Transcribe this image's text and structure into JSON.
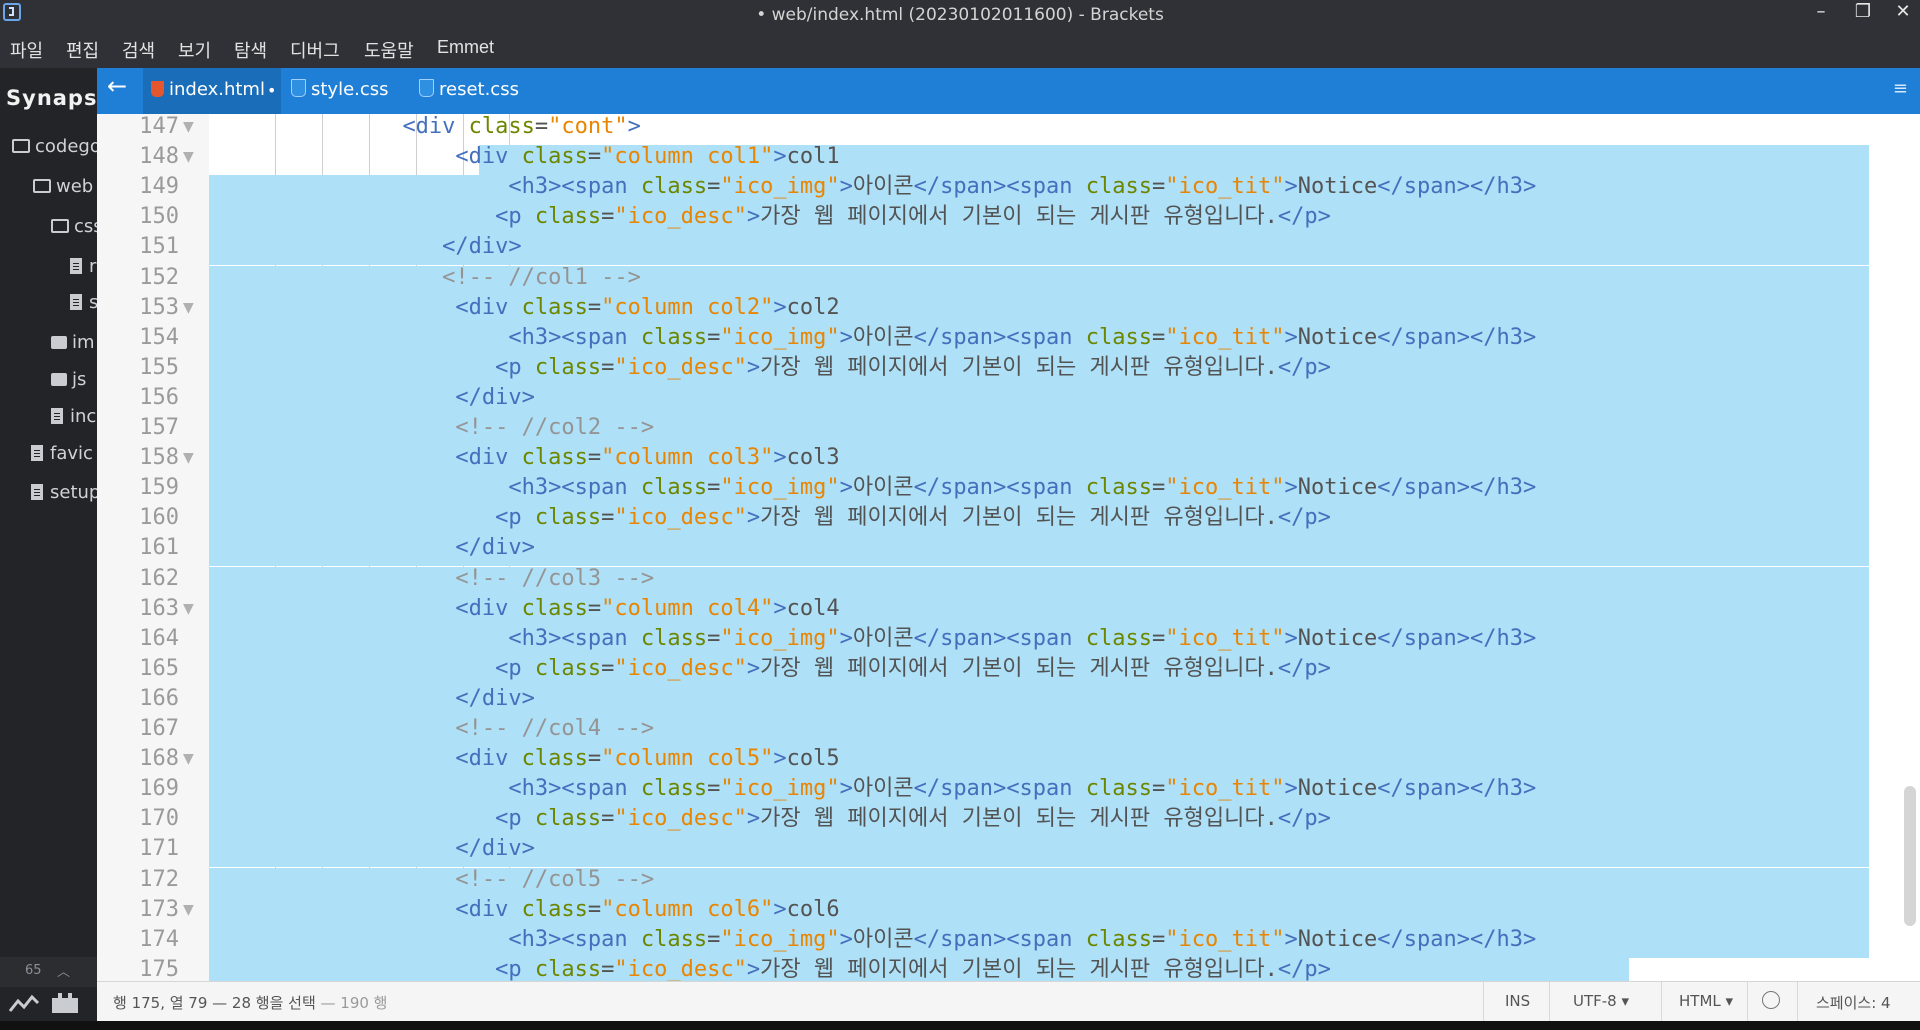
{
  "window": {
    "title": "• web/index.html (20230102011600) - Brackets",
    "minimize": "–",
    "restore": "❐",
    "close": "✕"
  },
  "menu": [
    "파일",
    "편집",
    "검색",
    "보기",
    "탐색",
    "디버그",
    "도움말",
    "Emmet"
  ],
  "sidebar": {
    "project": "Synapse",
    "items": [
      {
        "label": "codego",
        "type": "folder-open"
      },
      {
        "label": "web",
        "type": "folder-open"
      },
      {
        "label": "css",
        "type": "folder-open"
      },
      {
        "label": "r",
        "type": "file"
      },
      {
        "label": "s",
        "type": "file"
      },
      {
        "label": "im",
        "type": "folder"
      },
      {
        "label": "js",
        "type": "folder"
      },
      {
        "label": "inc",
        "type": "file"
      },
      {
        "label": "favic",
        "type": "file"
      },
      {
        "label": "setup",
        "type": "file"
      }
    ],
    "counter": "65"
  },
  "tabs": [
    {
      "name": "index.html",
      "active": true,
      "dirty": "•",
      "icon_color": "#e4572e"
    },
    {
      "name": "style.css",
      "active": false,
      "icon_color": "#2f8fe0"
    },
    {
      "name": "reset.css",
      "active": false,
      "icon_color": "#2f8fe0"
    }
  ],
  "editor": {
    "lines": [
      {
        "n": "147",
        "fold": true,
        "code": "              <div class=\"cont\">"
      },
      {
        "n": "148",
        "fold": true,
        "code": "                  <div class=\"column col1\">col1"
      },
      {
        "n": "149",
        "fold": false,
        "code": "                      <h3><span class=\"ico_img\">아이콘</span><span class=\"ico_tit\">Notice</span></h3>"
      },
      {
        "n": "150",
        "fold": false,
        "code": "                     <p class=\"ico_desc\">가장 웹 페이지에서 기본이 되는 게시판 유형입니다.</p>"
      },
      {
        "n": "151",
        "fold": false,
        "code": "                 </div>"
      },
      {
        "n": "152",
        "fold": false,
        "code": "                 <!-- //col1 -->"
      },
      {
        "n": "153",
        "fold": true,
        "code": "                  <div class=\"column col2\">col2"
      },
      {
        "n": "154",
        "fold": false,
        "code": "                      <h3><span class=\"ico_img\">아이콘</span><span class=\"ico_tit\">Notice</span></h3>"
      },
      {
        "n": "155",
        "fold": false,
        "code": "                     <p class=\"ico_desc\">가장 웹 페이지에서 기본이 되는 게시판 유형입니다.</p>"
      },
      {
        "n": "156",
        "fold": false,
        "code": "                  </div>"
      },
      {
        "n": "157",
        "fold": false,
        "code": "                  <!-- //col2 -->"
      },
      {
        "n": "158",
        "fold": true,
        "code": "                  <div class=\"column col3\">col3"
      },
      {
        "n": "159",
        "fold": false,
        "code": "                      <h3><span class=\"ico_img\">아이콘</span><span class=\"ico_tit\">Notice</span></h3>"
      },
      {
        "n": "160",
        "fold": false,
        "code": "                     <p class=\"ico_desc\">가장 웹 페이지에서 기본이 되는 게시판 유형입니다.</p>"
      },
      {
        "n": "161",
        "fold": false,
        "code": "                  </div>"
      },
      {
        "n": "162",
        "fold": false,
        "code": "                  <!-- //col3 -->"
      },
      {
        "n": "163",
        "fold": true,
        "code": "                  <div class=\"column col4\">col4"
      },
      {
        "n": "164",
        "fold": false,
        "code": "                      <h3><span class=\"ico_img\">아이콘</span><span class=\"ico_tit\">Notice</span></h3>"
      },
      {
        "n": "165",
        "fold": false,
        "code": "                     <p class=\"ico_desc\">가장 웹 페이지에서 기본이 되는 게시판 유형입니다.</p>"
      },
      {
        "n": "166",
        "fold": false,
        "code": "                  </div>"
      },
      {
        "n": "167",
        "fold": false,
        "code": "                  <!-- //col4 -->"
      },
      {
        "n": "168",
        "fold": true,
        "code": "                  <div class=\"column col5\">col5"
      },
      {
        "n": "169",
        "fold": false,
        "code": "                      <h3><span class=\"ico_img\">아이콘</span><span class=\"ico_tit\">Notice</span></h3>"
      },
      {
        "n": "170",
        "fold": false,
        "code": "                     <p class=\"ico_desc\">가장 웹 페이지에서 기본이 되는 게시판 유형입니다.</p>"
      },
      {
        "n": "171",
        "fold": false,
        "code": "                  </div>"
      },
      {
        "n": "172",
        "fold": false,
        "code": "                  <!-- //col5 -->"
      },
      {
        "n": "173",
        "fold": true,
        "code": "                  <div class=\"column col6\">col6"
      },
      {
        "n": "174",
        "fold": false,
        "code": "                      <h3><span class=\"ico_img\">아이콘</span><span class=\"ico_tit\">Notice</span></h3>"
      },
      {
        "n": "175",
        "fold": false,
        "code": "                     <p class=\"ico_desc\">가장 웹 페이지에서 기본이 되는 게시판 유형입니다.</p>"
      }
    ]
  },
  "status": {
    "cursor": "행 175, 열 79 — 28 행을 선택",
    "total": " — 190 행",
    "ins": "INS",
    "encoding": "UTF-8",
    "language": "HTML",
    "indent": "스페이스: 4"
  }
}
